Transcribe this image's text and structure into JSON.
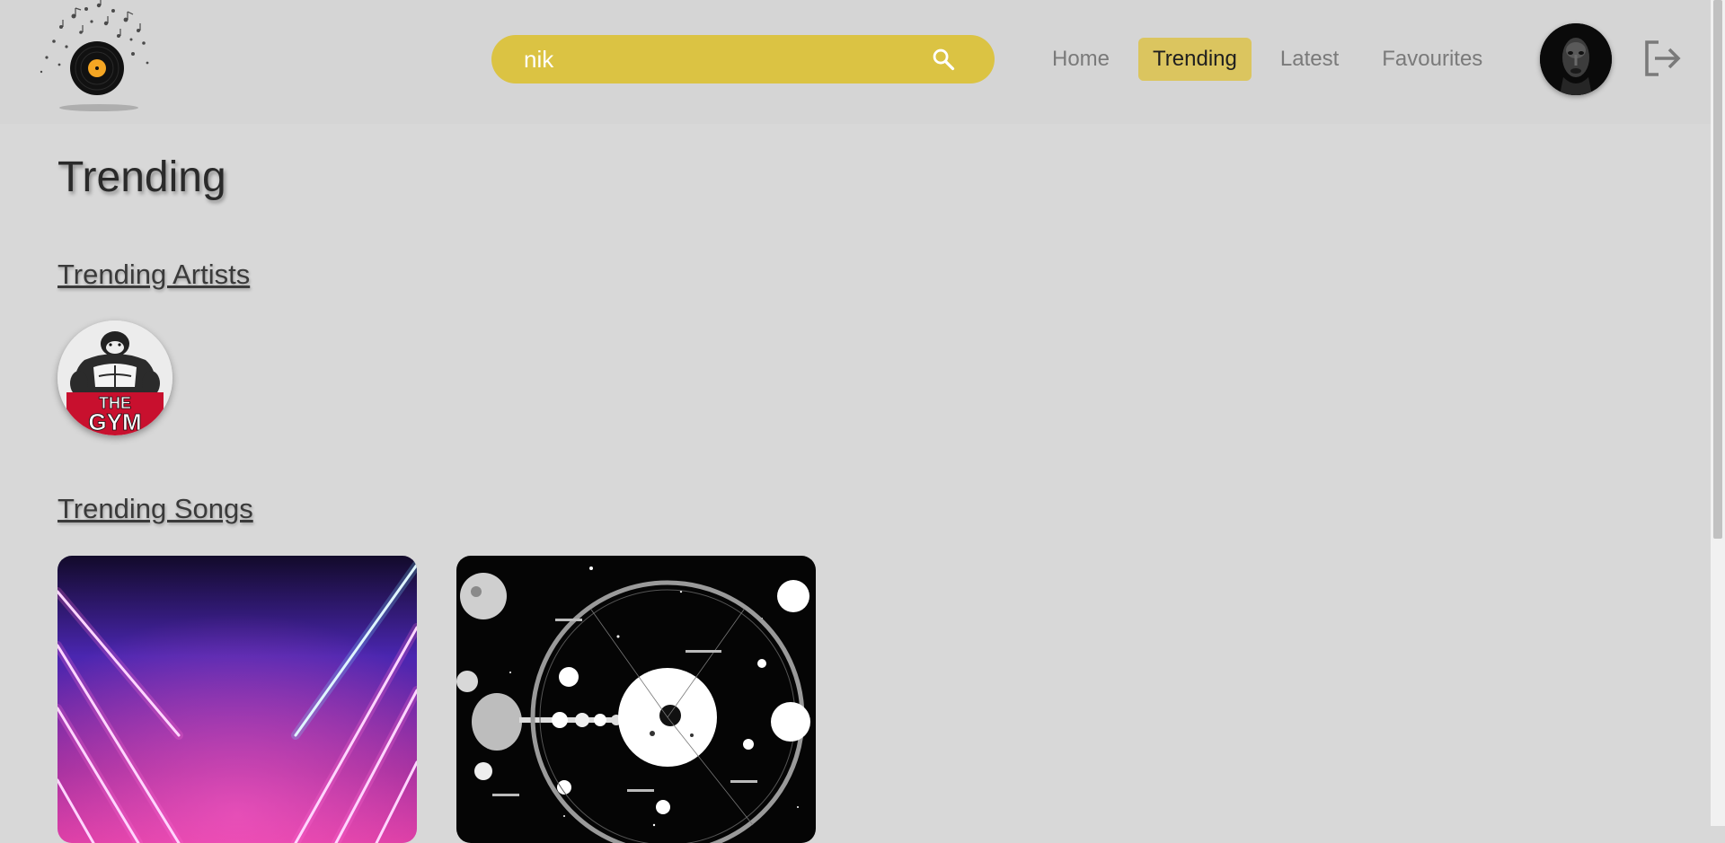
{
  "search": {
    "value": "nik",
    "placeholder": "Search"
  },
  "nav": {
    "items": [
      {
        "label": "Home"
      },
      {
        "label": "Trending"
      },
      {
        "label": "Latest"
      },
      {
        "label": "Favourites"
      }
    ],
    "active": "Trending"
  },
  "main": {
    "title": "Trending",
    "trending_artists": {
      "heading": "Trending Artists",
      "artist_logo_text": "THE GYM"
    },
    "trending_songs": {
      "heading": "Trending Songs"
    }
  },
  "colors": {
    "accent": "#dbc343",
    "nav_active_bg": "#dbc55f",
    "page_bg": "#d8d8d8",
    "header_bg": "#d5d5d5"
  },
  "icons": {
    "search": "search-icon",
    "logout": "logout-icon"
  }
}
